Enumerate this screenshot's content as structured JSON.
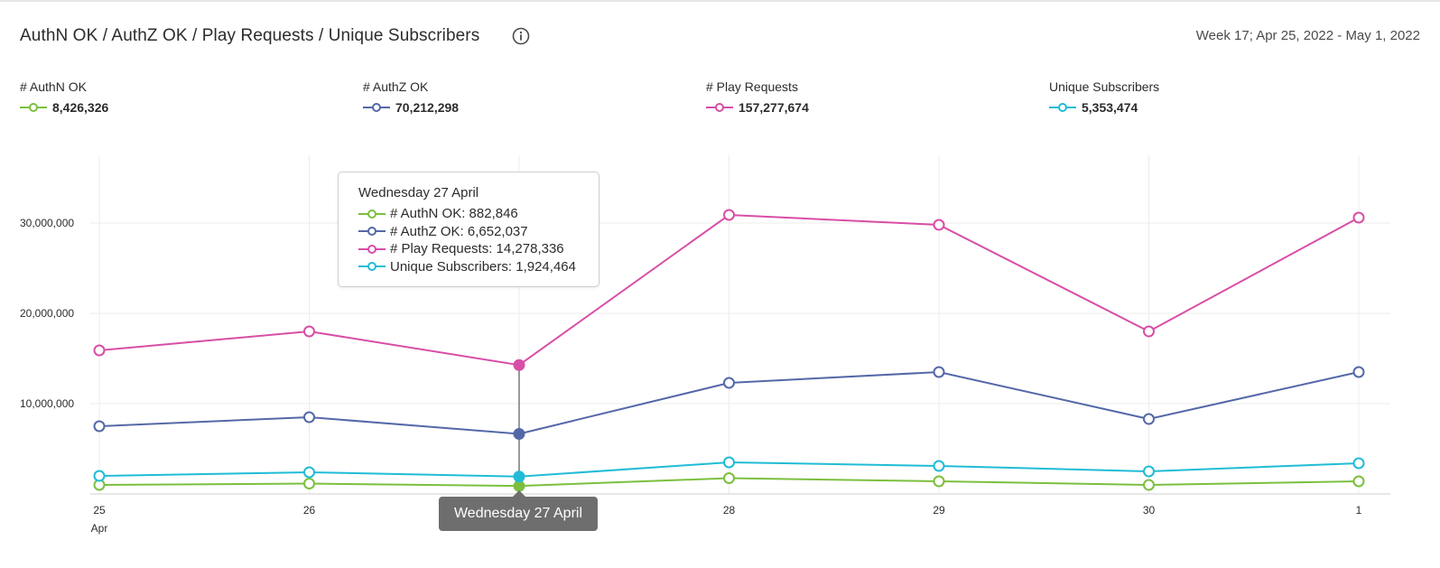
{
  "header": {
    "title": "AuthN OK / AuthZ OK / Play Requests / Unique Subscribers",
    "info_icon": "info-icon",
    "date_range": "Week 17; Apr 25, 2022 - May 1, 2022"
  },
  "metrics": [
    {
      "label": "# AuthN OK",
      "value": "8,426,326",
      "color": "#7cbf3f"
    },
    {
      "label": "# AuthZ OK",
      "value": "70,212,298",
      "color": "#5468a8"
    },
    {
      "label": "# Play Requests",
      "value": "157,277,674",
      "color": "#d84ea6"
    },
    {
      "label": "Unique Subscribers",
      "value": "5,353,474",
      "color": "#20bcd6"
    }
  ],
  "chart_data": {
    "type": "line",
    "categories": [
      "25",
      "26",
      "27",
      "28",
      "29",
      "30",
      "1"
    ],
    "x_sublabel": "Apr",
    "ylim": [
      0,
      37500000
    ],
    "yticks": [
      10000000,
      20000000,
      30000000
    ],
    "ytick_labels": [
      "10,000,000",
      "20,000,000",
      "30,000,000"
    ],
    "grid": true,
    "legend": "top",
    "series": [
      {
        "name": "# AuthN OK",
        "color": "#7cbf3f",
        "values": [
          1000000,
          1150000,
          882846,
          1750000,
          1400000,
          1000000,
          1400000
        ]
      },
      {
        "name": "# AuthZ OK",
        "color": "#5468a8",
        "values": [
          7500000,
          8500000,
          6652037,
          12300000,
          13500000,
          8300000,
          13500000
        ]
      },
      {
        "name": "# Play Requests",
        "color": "#d84ea6",
        "values": [
          15900000,
          18000000,
          14278336,
          30900000,
          29800000,
          18000000,
          30600000
        ]
      },
      {
        "name": "Unique Subscribers",
        "color": "#20bcd6",
        "values": [
          2000000,
          2400000,
          1924464,
          3500000,
          3100000,
          2500000,
          3400000
        ]
      }
    ],
    "highlight_index": 2
  },
  "tooltip": {
    "title": "Wednesday 27 April",
    "rows": [
      {
        "text": "# AuthN OK: 882,846",
        "color": "#7cbf3f"
      },
      {
        "text": "# AuthZ OK: 6,652,037",
        "color": "#5468a8"
      },
      {
        "text": "# Play Requests: 14,278,336",
        "color": "#d84ea6"
      },
      {
        "text": "Unique Subscribers: 1,924,464",
        "color": "#20bcd6"
      }
    ]
  },
  "x_flag": "Wednesday 27 April"
}
